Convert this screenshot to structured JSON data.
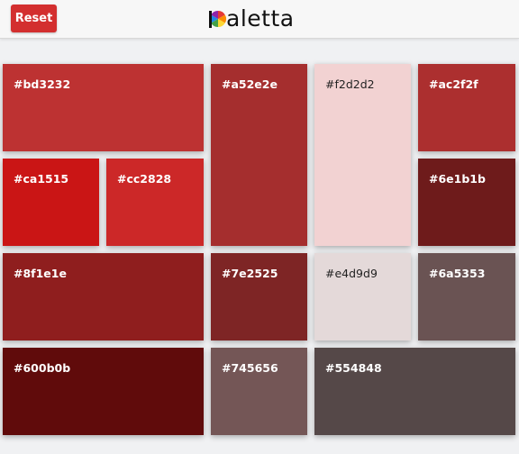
{
  "header": {
    "reset_label": "Reset",
    "reset_color": "#d32f2f",
    "logo_text": "aletta"
  },
  "swatches": [
    {
      "hex": "#bd3232",
      "color": "#bd3232"
    },
    {
      "hex": "#a52e2e",
      "color": "#a52e2e"
    },
    {
      "hex": "#f2d2d2",
      "color": "#f2d2d2"
    },
    {
      "hex": "#ac2f2f",
      "color": "#ac2f2f"
    },
    {
      "hex": "#ca1515",
      "color": "#ca1515"
    },
    {
      "hex": "#cc2828",
      "color": "#cc2828"
    },
    {
      "hex": "#6e1b1b",
      "color": "#6e1b1b"
    },
    {
      "hex": "#8f1e1e",
      "color": "#8f1e1e"
    },
    {
      "hex": "#7e2525",
      "color": "#7e2525"
    },
    {
      "hex": "#e4d9d9",
      "color": "#e4d9d9"
    },
    {
      "hex": "#6a5353",
      "color": "#6a5353"
    },
    {
      "hex": "#600b0b",
      "color": "#600b0b"
    },
    {
      "hex": "#745656",
      "color": "#745656"
    },
    {
      "hex": "#554848",
      "color": "#554848"
    }
  ]
}
